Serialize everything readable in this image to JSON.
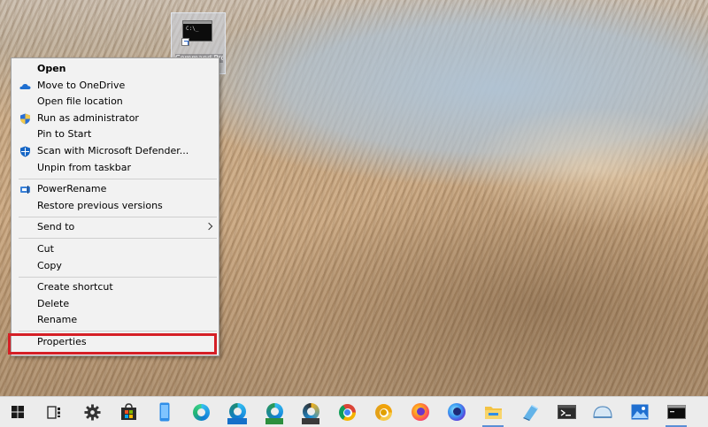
{
  "desktop_icon": {
    "label": "Command Prompt",
    "screen_text": "C:\\_"
  },
  "context_menu": {
    "items": [
      {
        "label": "Open",
        "bold": true
      },
      {
        "label": "Move to OneDrive",
        "icon": "onedrive-icon"
      },
      {
        "label": "Open file location"
      },
      {
        "label": "Run as administrator",
        "icon": "uac-shield-icon"
      },
      {
        "label": "Pin to Start"
      },
      {
        "label": "Scan with Microsoft Defender...",
        "icon": "defender-icon"
      },
      {
        "label": "Unpin from taskbar"
      },
      {
        "label": "PowerRename",
        "icon": "powerrename-icon"
      },
      {
        "label": "Restore previous versions"
      },
      {
        "label": "Send to",
        "submenu": true
      },
      {
        "label": "Cut"
      },
      {
        "label": "Copy"
      },
      {
        "label": "Create shortcut"
      },
      {
        "label": "Delete"
      },
      {
        "label": "Rename"
      },
      {
        "label": "Properties",
        "highlighted": true
      }
    ],
    "highlight_color": "#d51f26"
  },
  "taskbar": {
    "icons": [
      "windows-start-icon",
      "task-view-icon",
      "settings-icon",
      "microsoft-store-icon",
      "phone-link-icon",
      "edge-icon",
      "edge-beta-icon",
      "edge-dev-icon",
      "edge-canary-icon",
      "chrome-icon",
      "chrome-canary-icon",
      "firefox-icon",
      "firefox-nightly-icon",
      "file-explorer-icon",
      "snipping-icon",
      "windows-terminal-icon",
      "dock-icon",
      "photos-icon",
      "command-prompt-icon"
    ]
  }
}
